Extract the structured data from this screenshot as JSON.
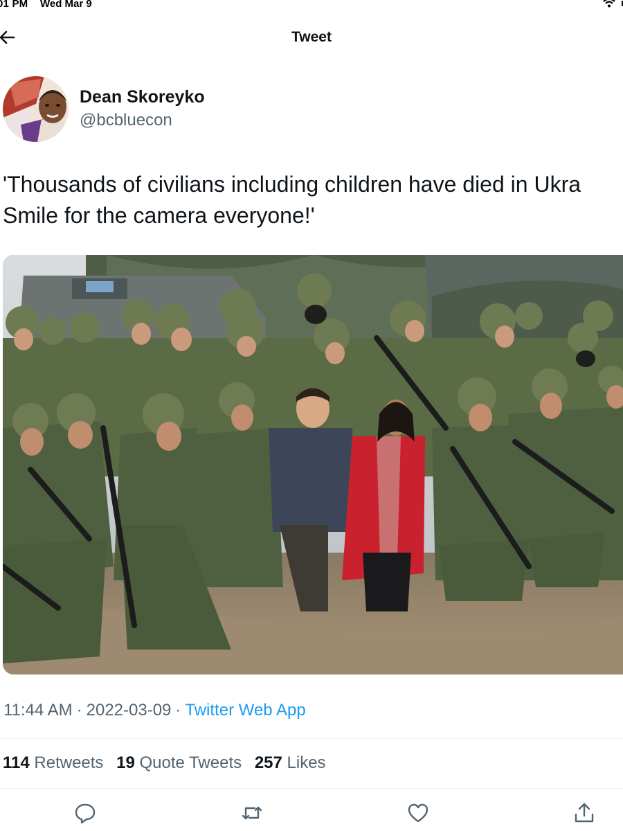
{
  "status_bar": {
    "time": "01 PM",
    "date": "Wed Mar 9"
  },
  "nav": {
    "title": "Tweet",
    "back_icon": "arrow-left-icon"
  },
  "author": {
    "display_name": "Dean Skoreyko",
    "handle": "@bcbluecon"
  },
  "tweet": {
    "text": "'Thousands of civilians including children have died in Ukra\nSmile for the camera everyone!'"
  },
  "meta": {
    "time": "11:44 AM",
    "date": "2022-03-09",
    "source": "Twitter Web App",
    "separator": "·"
  },
  "stats": {
    "retweets": {
      "count": "114",
      "label": "Retweets"
    },
    "quotes": {
      "count": "19",
      "label": "Quote Tweets"
    },
    "likes": {
      "count": "257",
      "label": "Likes"
    }
  },
  "actions": [
    "reply-icon",
    "retweet-icon",
    "like-icon",
    "share-icon"
  ],
  "colors": {
    "link": "#1d9bf0",
    "secondary_text": "#536471",
    "divider": "#eff3f4"
  }
}
